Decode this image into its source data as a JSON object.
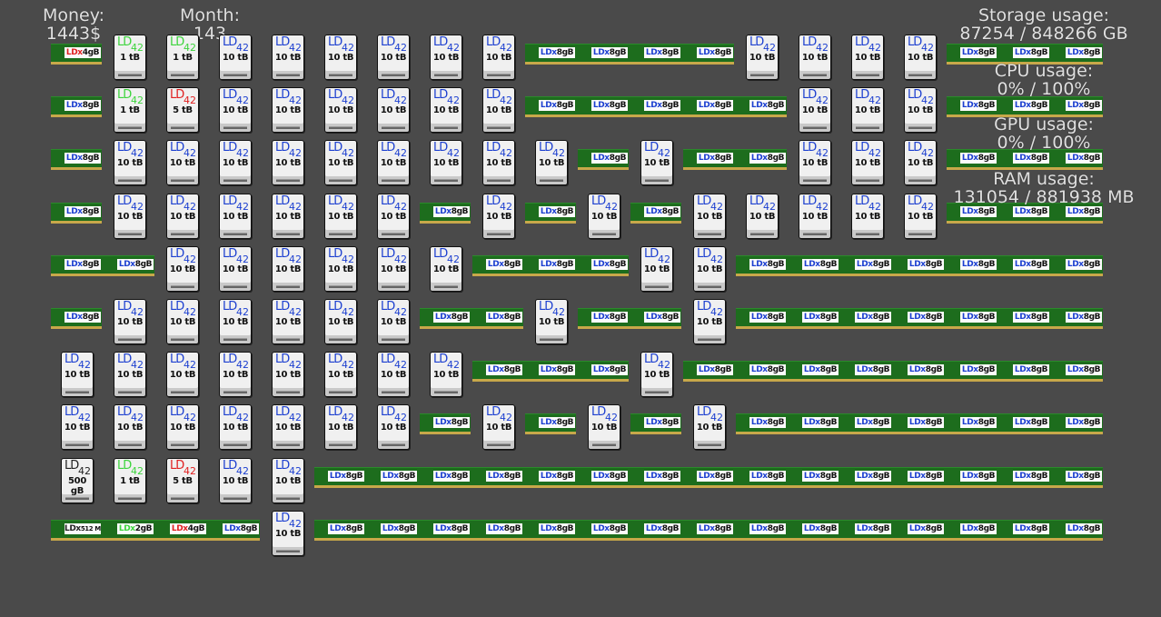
{
  "stats": {
    "money_label": "Money:",
    "money_value": "1443$",
    "month_label": "Month:",
    "month_value": "143",
    "storage_label": "Storage usage:",
    "storage_value": "87254 / 848266 GB",
    "cpu_label": "CPU usage:",
    "cpu_value": "0% / 100%",
    "gpu_label": "GPU usage:",
    "gpu_value": "0% / 100%",
    "ram_label": "RAM usage:",
    "ram_value": "131054 / 881938 MB"
  },
  "colors": {
    "background": "#4a4a4a",
    "brand_blue": "#1c3fd0",
    "tier_green": "#3cd43c",
    "tier_red": "#e02020",
    "pcb_green": "#1d6d1d",
    "pcb_gold": "#c8a84a"
  },
  "brand": {
    "hdd_brand": "LD",
    "hdd_version": "42",
    "ram_brand": "LDx"
  },
  "components": {
    "hdd_10tb": "10 tB",
    "hdd_5tb": "5 tB",
    "hdd_1tb": "1 tB",
    "hdd_500gb": "500 gB",
    "ram_8gb": "8gB",
    "ram_4gb": "4gB",
    "ram_2gb": "2gB",
    "ram_512mb": "512 MB"
  },
  "rows": [
    "r4 h1g h1g H H H H H H R R R R H H H H R R R",
    "R h1g h5r H H H H H H R R R R R H H H R R R",
    "R H H H H H H H H H R H R R H H H R R R",
    "R H H H H H H R H R H R H H H H H R R R",
    "R R H H H H H H R R R H H R R R R R R R",
    "R H H H H H H R R H R R H R R R R R R R",
    "H H H H H H H H R R R H R R R R R R R R",
    "H H H H H H H R H R H R H R R R R R R R",
    "h500 h1g h5r H H R R R R R R R R R R R R R R R",
    "r512 r2 r4 R H R R R R R R R R R R R R R R R"
  ]
}
